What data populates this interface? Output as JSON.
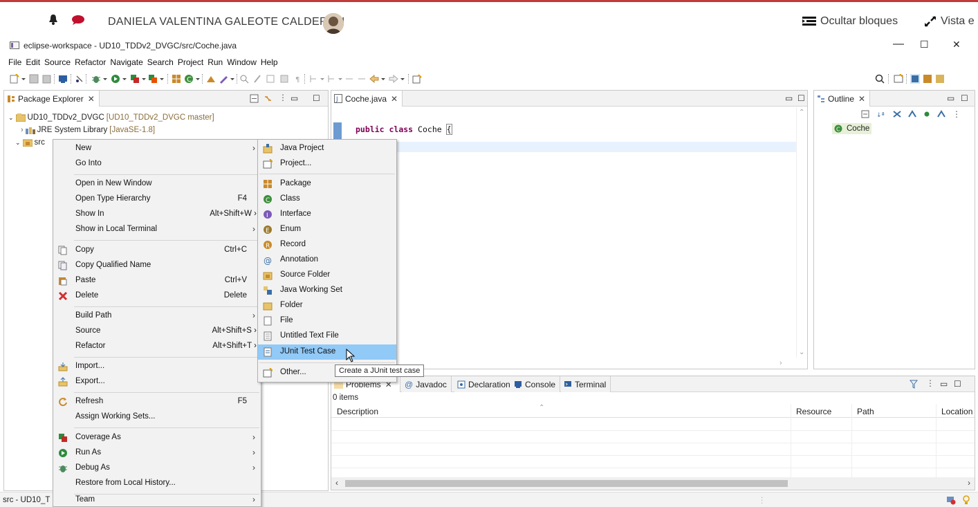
{
  "userbar": {
    "user_name": "DANIELA VALENTINA GALEOTE CALDERON",
    "hide_blocks": "Ocultar bloques",
    "view": "Vista e"
  },
  "window": {
    "title": "eclipse-workspace - UD10_TDDv2_DVGC/src/Coche.java",
    "minimize": "—",
    "maximize": "☐",
    "close": "✕"
  },
  "menubar": [
    "File",
    "Edit",
    "Source",
    "Refactor",
    "Navigate",
    "Search",
    "Project",
    "Run",
    "Window",
    "Help"
  ],
  "package_explorer": {
    "tab": "Package Explorer",
    "project": "UD10_TDDv2_DVGC",
    "project_repo": "[UD10_TDDv2_DVGC master]",
    "jre": "JRE System Library",
    "jre_version": "[JavaSE-1.8]",
    "src": "src"
  },
  "editor": {
    "tab": "Coche.java",
    "code_keyword1": "public",
    "code_keyword2": "class",
    "code_name": "Coche",
    "code_brace": "{"
  },
  "outline": {
    "tab": "Outline",
    "item": "Coche"
  },
  "bottom_panel": {
    "tabs": [
      "Problems",
      "Javadoc",
      "Declaration",
      "Console",
      "Terminal"
    ],
    "count": "0 items",
    "columns": [
      "Description",
      "Resource",
      "Path",
      "Location"
    ]
  },
  "status": {
    "text": "src - UD10_T"
  },
  "context_menu": {
    "items": [
      {
        "label": "New",
        "arrow": "›"
      },
      {
        "label": "Go Into"
      },
      {
        "label": "Open in New Window"
      },
      {
        "label": "Open Type Hierarchy",
        "accel": "F4"
      },
      {
        "label": "Show In",
        "accel": "Alt+Shift+W ›"
      },
      {
        "label": "Show in Local Terminal",
        "arrow": "›"
      },
      {
        "label": "Copy",
        "accel": "Ctrl+C"
      },
      {
        "label": "Copy Qualified Name"
      },
      {
        "label": "Paste",
        "accel": "Ctrl+V"
      },
      {
        "label": "Delete",
        "accel": "Delete"
      },
      {
        "label": "Build Path",
        "arrow": "›"
      },
      {
        "label": "Source",
        "accel": "Alt+Shift+S ›"
      },
      {
        "label": "Refactor",
        "accel": "Alt+Shift+T ›"
      },
      {
        "label": "Import..."
      },
      {
        "label": "Export..."
      },
      {
        "label": "Refresh",
        "accel": "F5"
      },
      {
        "label": "Assign Working Sets..."
      },
      {
        "label": "Coverage As",
        "arrow": "›"
      },
      {
        "label": "Run As",
        "arrow": "›"
      },
      {
        "label": "Debug As",
        "arrow": "›"
      },
      {
        "label": "Restore from Local History..."
      },
      {
        "label": "Team",
        "arrow": "›"
      }
    ]
  },
  "submenu": {
    "items": [
      {
        "label": "Java Project"
      },
      {
        "label": "Project..."
      },
      {
        "label": "Package"
      },
      {
        "label": "Class"
      },
      {
        "label": "Interface"
      },
      {
        "label": "Enum"
      },
      {
        "label": "Record"
      },
      {
        "label": "Annotation"
      },
      {
        "label": "Source Folder"
      },
      {
        "label": "Java Working Set"
      },
      {
        "label": "Folder"
      },
      {
        "label": "File"
      },
      {
        "label": "Untitled Text File"
      },
      {
        "label": "JUnit Test Case"
      },
      {
        "label": "Other..."
      }
    ]
  },
  "tooltip": "Create a JUnit test case",
  "colors": {
    "selection": "#91c9f7",
    "accent_red": "#c23b3b",
    "keyword": "#7f0055"
  }
}
